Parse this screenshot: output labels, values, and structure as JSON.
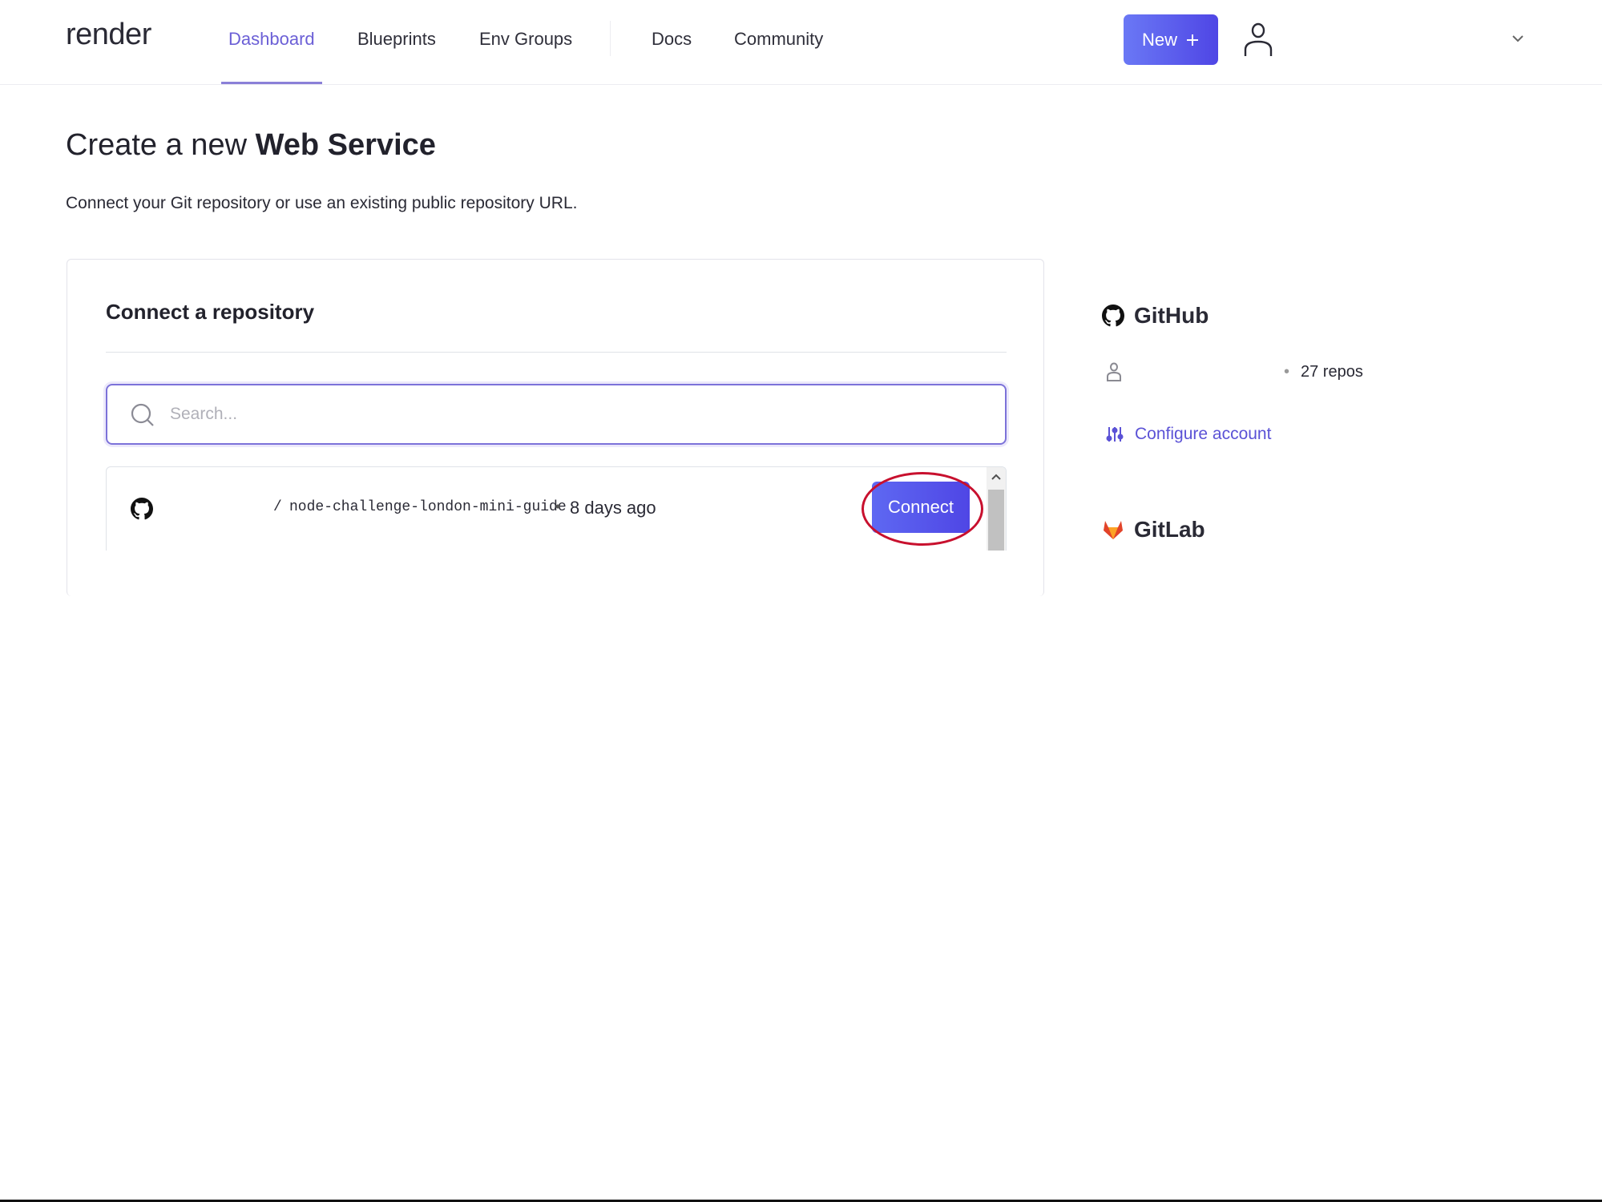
{
  "nav": {
    "logo": "render",
    "links": [
      {
        "label": "Dashboard",
        "active": true
      },
      {
        "label": "Blueprints",
        "active": false
      },
      {
        "label": "Env Groups",
        "active": false
      },
      {
        "label": "Docs",
        "active": false
      },
      {
        "label": "Community",
        "active": false
      }
    ],
    "new_button": {
      "label": "New",
      "icon": "plus-icon"
    },
    "avatar_icon": "user-icon",
    "menu_icon": "chevron-down-icon"
  },
  "page": {
    "title_prefix": "Create a new",
    "title_bold": "Web Service",
    "subtitle": "Connect your Git repository or use an existing public repository URL."
  },
  "connect_card": {
    "title": "Connect a repository",
    "search": {
      "placeholder": "Search...",
      "value": "",
      "icon": "search-icon"
    },
    "repos": [
      {
        "provider_icon": "github-icon",
        "separator": "/",
        "name": "node-challenge-london-mini-guide",
        "dot": "•",
        "updated": "8 days ago",
        "action": "Connect"
      }
    ]
  },
  "sidebar": {
    "github": {
      "label": "GitHub",
      "icon": "github-icon",
      "account_icon": "user-icon",
      "dot": "•",
      "repo_count": "27 repos",
      "configure_label": "Configure account",
      "configure_icon": "sliders-icon"
    },
    "gitlab": {
      "label": "GitLab",
      "icon": "gitlab-icon"
    }
  },
  "colors": {
    "accent": "#5b52d6",
    "button": "#4f46e5",
    "highlight": "#c8102e"
  }
}
